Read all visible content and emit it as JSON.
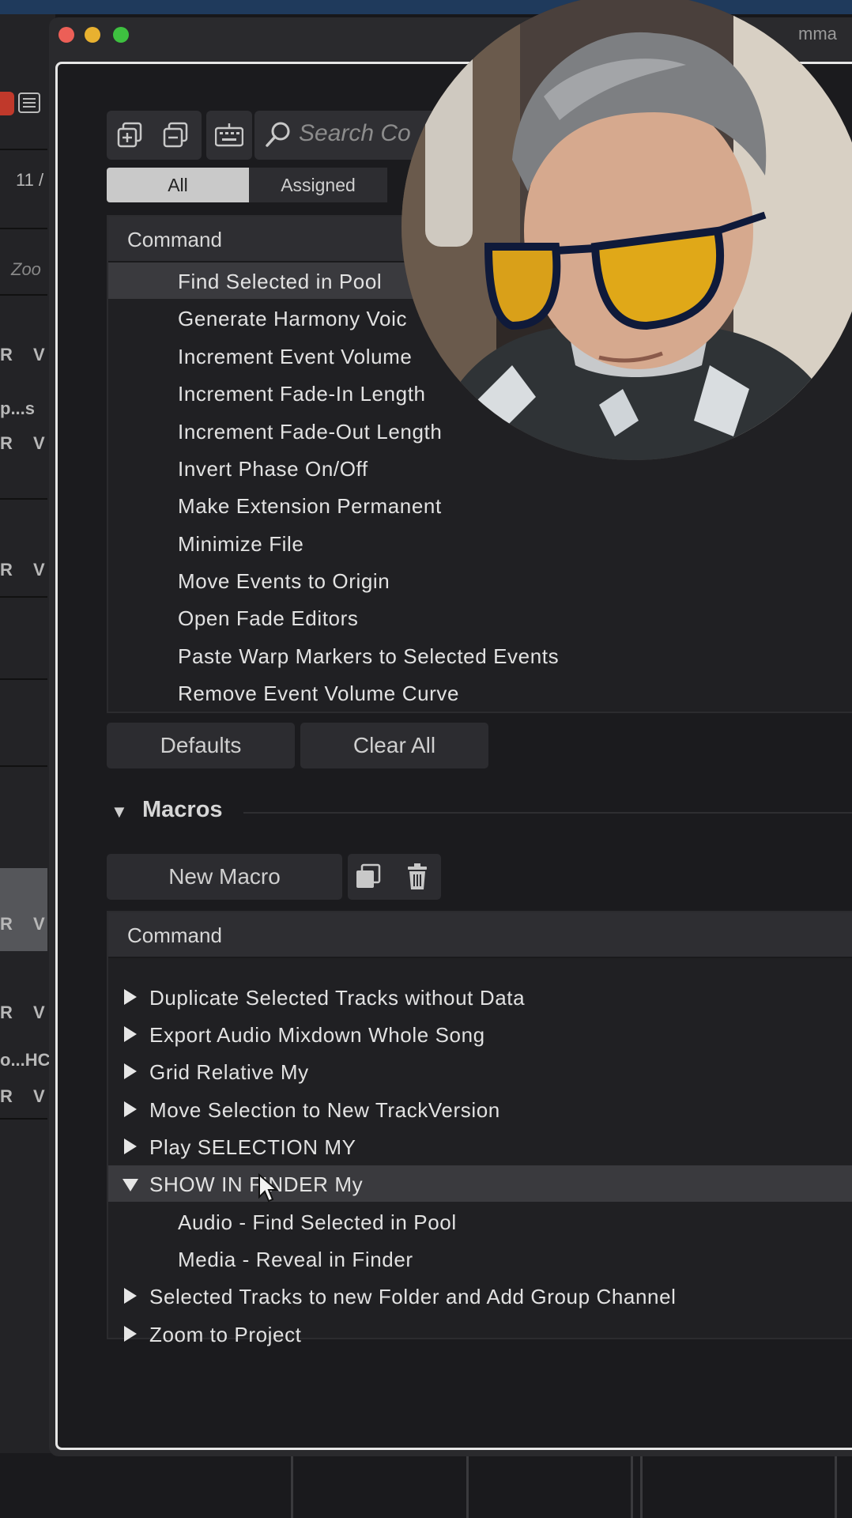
{
  "left_panel": {
    "fragments": [
      "11 /",
      "Zoo",
      "R",
      "V",
      "p...s",
      "R",
      "V",
      "R",
      "V",
      "R",
      "V",
      "R",
      "V",
      "o...HC",
      "R",
      "V"
    ]
  },
  "window": {
    "title_fragment": "mma"
  },
  "toolbar": {
    "search_placeholder": "Search Co",
    "icons": [
      "duplicate-icon",
      "remove-icon",
      "keyboard-icon",
      "search-icon"
    ]
  },
  "filter_tabs": [
    "All",
    "Assigned"
  ],
  "commands": {
    "header": "Command",
    "items": [
      "Find Selected in Pool",
      "Generate Harmony Voic",
      "Increment Event Volume",
      "Increment Fade-In Length",
      "Increment Fade-Out Length",
      "Invert Phase On/Off",
      "Make Extension Permanent",
      "Minimize File",
      "Move Events to Origin",
      "Open Fade Editors",
      "Paste Warp Markers to Selected Events",
      "Remove Event Volume Curve"
    ],
    "selected_index": 0
  },
  "buttons": {
    "defaults": "Defaults",
    "clear_all": "Clear All"
  },
  "macros": {
    "title": "Macros",
    "new_macro": "New Macro",
    "header": "Command",
    "items": [
      "Duplicate Selected Tracks without Data",
      "Export Audio Mixdown Whole Song",
      "Grid Relative My",
      "Move Selection to New TrackVersion",
      "Play SELECTION MY",
      "SHOW IN FINDER My",
      "Audio - Find Selected in Pool",
      "Media - Reveal in Finder",
      "Selected Tracks to new Folder and Add Group Channel",
      "Zoom to Project"
    ]
  }
}
